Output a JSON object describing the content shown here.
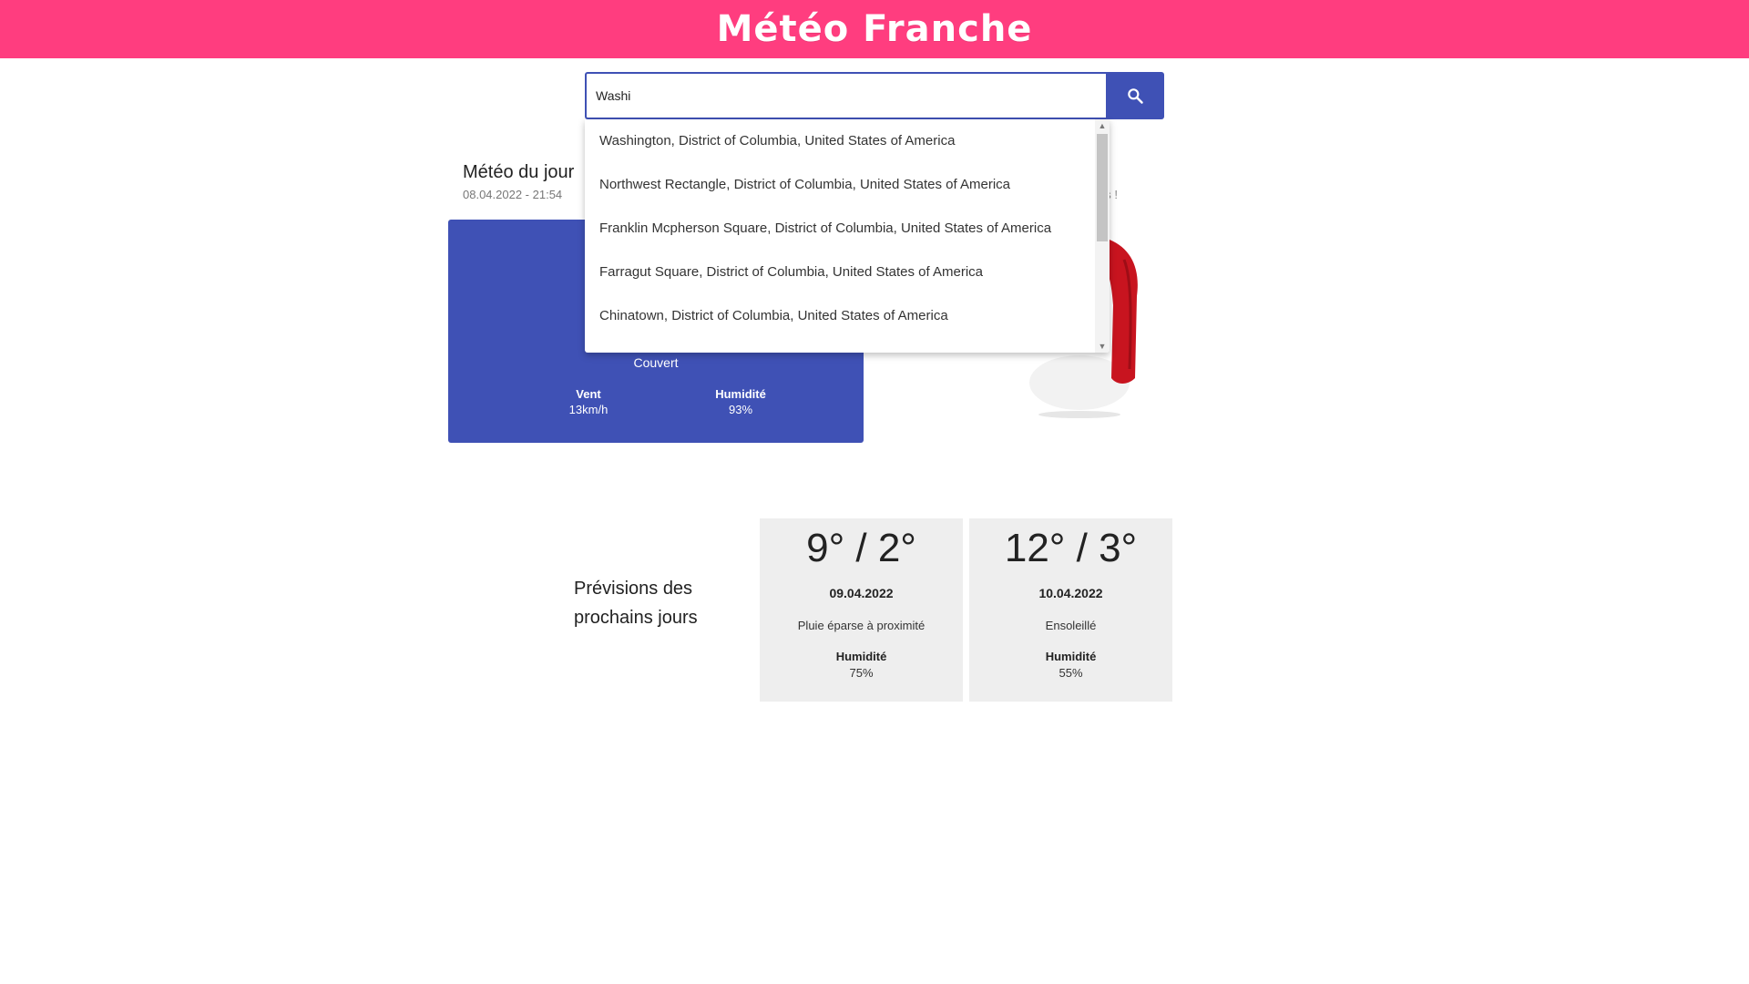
{
  "app": {
    "title": "Météo Franche"
  },
  "search": {
    "value": "Washi",
    "button_icon": "search-icon"
  },
  "suggestions": [
    "Washington, District of Columbia, United States of America",
    "Northwest Rectangle, District of Columbia, United States of America",
    "Franklin Mcpherson Square, District of Columbia, United States of America",
    "Farragut Square, District of Columbia, United States of America",
    "Chinatown, District of Columbia, United States of America"
  ],
  "today": {
    "title": "Météo du jour",
    "datetime": "08.04.2022 - 21:54",
    "side_caption_partial": "us !",
    "condition": "Couvert",
    "wind_label": "Vent",
    "wind_value": "13km/h",
    "humidity_label": "Humidité",
    "humidity_value": "93%",
    "illustration": "red-scarf"
  },
  "forecast": {
    "title": "Prévisions des prochains jours",
    "days": [
      {
        "temp": "9° / 2°",
        "date": "09.04.2022",
        "condition": "Pluie éparse à proximité",
        "humidity_label": "Humidité",
        "humidity_value": "75%"
      },
      {
        "temp": "12° / 3°",
        "date": "10.04.2022",
        "condition": "Ensoleillé",
        "humidity_label": "Humidité",
        "humidity_value": "55%"
      }
    ]
  },
  "colors": {
    "header": "#ff3d7f",
    "primary": "#3f51b5",
    "card_bg": "#eeeeee"
  }
}
